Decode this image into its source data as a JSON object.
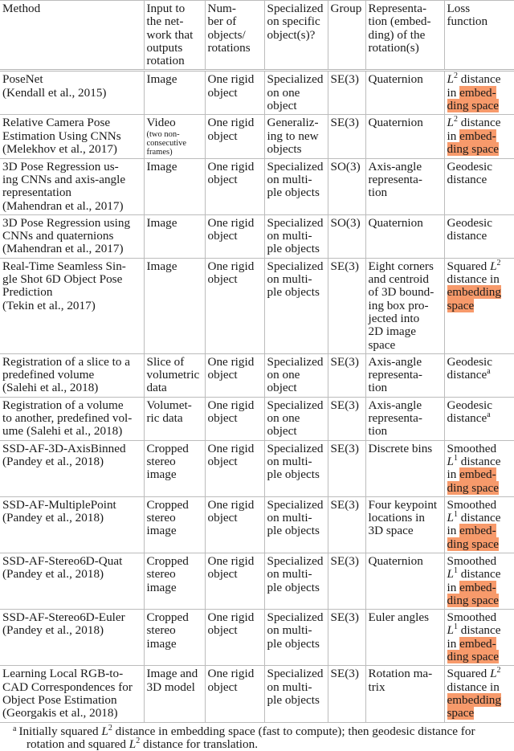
{
  "table": {
    "headers": [
      [
        "Method"
      ],
      [
        "Input to",
        "the net-",
        "work that",
        "outputs",
        "rotation"
      ],
      [
        "Num-",
        "ber of",
        "objects/",
        "rotations"
      ],
      [
        "Specialized",
        "on specific",
        "object(s)?"
      ],
      [
        "Group"
      ],
      [
        "Representa-",
        "tion (embed-",
        "ding) of the",
        "rotation(s)"
      ],
      [
        "Loss",
        "function"
      ]
    ],
    "rows": [
      {
        "method": [
          "PoseNet",
          "(Kendall et al., 2015)"
        ],
        "input": [
          "Image"
        ],
        "input_note": [],
        "objects": [
          "One rigid",
          "object"
        ],
        "specialized": [
          "Specialized",
          "on one",
          "object"
        ],
        "group": "SE(3)",
        "representation": [
          "Quaternion"
        ],
        "loss": [
          [
            {
              "t": "L",
              "it": true
            },
            {
              "sup": "2"
            },
            {
              "t": " distance"
            }
          ],
          [
            {
              "t": "in "
            },
            {
              "t": "embed-",
              "hl": true
            }
          ],
          [
            {
              "t": "ding space",
              "hl": true
            }
          ]
        ]
      },
      {
        "method": [
          "Relative Camera Pose",
          "Estimation Using CNNs",
          "(Melekhov et al., 2017)"
        ],
        "input": [
          "Video"
        ],
        "input_note": [
          "(two non-",
          "consecutive",
          "frames)"
        ],
        "objects": [
          "One rigid",
          "object"
        ],
        "specialized": [
          "Generaliz-",
          "ing to new",
          "objects"
        ],
        "group": "SE(3)",
        "representation": [
          "Quaternion"
        ],
        "loss": [
          [
            {
              "t": "L",
              "it": true
            },
            {
              "sup": "2"
            },
            {
              "t": " distance"
            }
          ],
          [
            {
              "t": "in "
            },
            {
              "t": "embed-",
              "hl": true
            }
          ],
          [
            {
              "t": "ding space",
              "hl": true
            }
          ]
        ]
      },
      {
        "method": [
          "3D Pose Regression us-",
          "ing CNNs and axis-angle",
          "representation",
          "(Mahendran et al., 2017)"
        ],
        "input": [
          "Image"
        ],
        "input_note": [],
        "objects": [
          "One rigid",
          "object"
        ],
        "specialized": [
          "Specialized",
          "on multi-",
          "ple objects"
        ],
        "group": "SO(3)",
        "representation": [
          "Axis-angle",
          "representa-",
          "tion"
        ],
        "loss": [
          [
            {
              "t": "Geodesic"
            }
          ],
          [
            {
              "t": "distance"
            }
          ]
        ]
      },
      {
        "method": [
          "3D Pose Regression using",
          "CNNs and quaternions",
          "(Mahendran et al., 2017)"
        ],
        "input": [
          "Image"
        ],
        "input_note": [],
        "objects": [
          "One rigid",
          "object"
        ],
        "specialized": [
          "Specialized",
          "on multi-",
          "ple objects"
        ],
        "group": "SO(3)",
        "representation": [
          "Quaternion"
        ],
        "loss": [
          [
            {
              "t": "Geodesic"
            }
          ],
          [
            {
              "t": "distance"
            }
          ]
        ]
      },
      {
        "method": [
          "Real-Time Seamless Sin-",
          "gle Shot 6D Object Pose",
          "Prediction",
          "(Tekin et al., 2017)"
        ],
        "input": [
          "Image"
        ],
        "input_note": [],
        "objects": [
          "One rigid",
          "object"
        ],
        "specialized": [
          "Specialized",
          "on multi-",
          "ple objects"
        ],
        "group": "SE(3)",
        "representation": [
          "Eight corners",
          "and centroid",
          "of 3D bound-",
          "ing box pro-",
          "jected into",
          "2D image",
          "space"
        ],
        "loss": [
          [
            {
              "t": "Squared "
            },
            {
              "t": "L",
              "it": true
            },
            {
              "sup": "2"
            }
          ],
          [
            {
              "t": "distance in"
            }
          ],
          [
            {
              "t": "embedding",
              "hl": true
            }
          ],
          [
            {
              "t": "space",
              "hl": true
            }
          ]
        ]
      },
      {
        "method": [
          "Registration of a slice to a",
          "predefined volume",
          "(Salehi et al., 2018)"
        ],
        "input": [
          "Slice of",
          "volumetric",
          "data"
        ],
        "input_note": [],
        "objects": [
          "One rigid",
          "object"
        ],
        "specialized": [
          "Specialized",
          "on one",
          "object"
        ],
        "group": "SE(3)",
        "representation": [
          "Axis-angle",
          "representa-",
          "tion"
        ],
        "loss": [
          [
            {
              "t": "Geodesic"
            }
          ],
          [
            {
              "t": "distance"
            },
            {
              "sup": "a"
            }
          ]
        ]
      },
      {
        "method": [
          "Registration of a volume",
          "to another, predefined vol-",
          "ume (Salehi et al., 2018)"
        ],
        "input": [
          "Volumet-",
          "ric data"
        ],
        "input_note": [],
        "objects": [
          "One rigid",
          "object"
        ],
        "specialized": [
          "Specialized",
          "on one",
          "object"
        ],
        "group": "SE(3)",
        "representation": [
          "Axis-angle",
          "representa-",
          "tion"
        ],
        "loss": [
          [
            {
              "t": "Geodesic"
            }
          ],
          [
            {
              "t": "distance"
            },
            {
              "sup": "a"
            }
          ]
        ]
      },
      {
        "method": [
          "SSD-AF-3D-AxisBinned",
          "(Pandey et al., 2018)"
        ],
        "input": [
          "Cropped",
          "stereo",
          "image"
        ],
        "input_note": [],
        "objects": [
          "One rigid",
          "object"
        ],
        "specialized": [
          "Specialized",
          "on multi-",
          "ple objects"
        ],
        "group": "SE(3)",
        "representation": [
          "Discrete bins"
        ],
        "loss": [
          [
            {
              "t": "Smoothed"
            }
          ],
          [
            {
              "t": "L",
              "it": true
            },
            {
              "sup": "1"
            },
            {
              "t": " distance"
            }
          ],
          [
            {
              "t": "in "
            },
            {
              "t": "embed-",
              "hl": true
            }
          ],
          [
            {
              "t": "ding space",
              "hl": true
            }
          ]
        ]
      },
      {
        "method": [
          "SSD-AF-MultiplePoint",
          "(Pandey et al., 2018)"
        ],
        "input": [
          "Cropped",
          "stereo",
          "image"
        ],
        "input_note": [],
        "objects": [
          "One rigid",
          "object"
        ],
        "specialized": [
          "Specialized",
          "on multi-",
          "ple objects"
        ],
        "group": "SE(3)",
        "representation": [
          "Four keypoint",
          "locations in",
          "3D space"
        ],
        "loss": [
          [
            {
              "t": "Smoothed"
            }
          ],
          [
            {
              "t": "L",
              "it": true
            },
            {
              "sup": "1"
            },
            {
              "t": " distance"
            }
          ],
          [
            {
              "t": "in "
            },
            {
              "t": "embed-",
              "hl": true
            }
          ],
          [
            {
              "t": "ding space",
              "hl": true
            }
          ]
        ]
      },
      {
        "method": [
          "SSD-AF-Stereo6D-Quat",
          "(Pandey et al., 2018)"
        ],
        "input": [
          "Cropped",
          "stereo",
          "image"
        ],
        "input_note": [],
        "objects": [
          "One rigid",
          "object"
        ],
        "specialized": [
          "Specialized",
          "on multi-",
          "ple objects"
        ],
        "group": "SE(3)",
        "representation": [
          "Quaternion"
        ],
        "loss": [
          [
            {
              "t": "Smoothed"
            }
          ],
          [
            {
              "t": "L",
              "it": true
            },
            {
              "sup": "1"
            },
            {
              "t": " distance"
            }
          ],
          [
            {
              "t": "in "
            },
            {
              "t": "embed-",
              "hl": true
            }
          ],
          [
            {
              "t": "ding space",
              "hl": true
            }
          ]
        ]
      },
      {
        "method": [
          "SSD-AF-Stereo6D-Euler",
          "(Pandey et al., 2018)"
        ],
        "input": [
          "Cropped",
          "stereo",
          "image"
        ],
        "input_note": [],
        "objects": [
          "One rigid",
          "object"
        ],
        "specialized": [
          "Specialized",
          "on multi-",
          "ple objects"
        ],
        "group": "SE(3)",
        "representation": [
          "Euler angles"
        ],
        "loss": [
          [
            {
              "t": "Smoothed"
            }
          ],
          [
            {
              "t": "L",
              "it": true
            },
            {
              "sup": "1"
            },
            {
              "t": " distance"
            }
          ],
          [
            {
              "t": "in "
            },
            {
              "t": "embed-",
              "hl": true
            }
          ],
          [
            {
              "t": "ding space",
              "hl": true
            }
          ]
        ]
      },
      {
        "method": [
          "Learning Local RGB-to-",
          "CAD Correspondences for",
          "Object Pose Estimation",
          "(Georgakis et al., 2018)"
        ],
        "input": [
          "Image and",
          "3D model"
        ],
        "input_note": [],
        "objects": [
          "One rigid",
          "object"
        ],
        "specialized": [
          "Specialized",
          "on multi-",
          "ple objects"
        ],
        "group": "SE(3)",
        "representation": [
          "Rotation ma-",
          "trix"
        ],
        "loss": [
          [
            {
              "t": "Squared "
            },
            {
              "t": "L",
              "it": true
            },
            {
              "sup": "2"
            }
          ],
          [
            {
              "t": "distance in"
            }
          ],
          [
            {
              "t": "embedding",
              "hl": true
            }
          ],
          [
            {
              "t": "space",
              "hl": true
            }
          ]
        ]
      }
    ]
  },
  "footnote": {
    "mark": "a",
    "line1": [
      {
        "t": "Initially squared "
      },
      {
        "t": "L",
        "it": true
      },
      {
        "sup": "2"
      },
      {
        "t": " distance in embedding space (fast to compute); then geodesic distance for"
      }
    ],
    "line2": [
      {
        "t": "rotation and squared "
      },
      {
        "t": "L",
        "it": true
      },
      {
        "sup": "2"
      },
      {
        "t": " distance for translation."
      }
    ]
  },
  "colors": {
    "highlight": "#f79a6b",
    "grid": "#bcbcbc"
  }
}
